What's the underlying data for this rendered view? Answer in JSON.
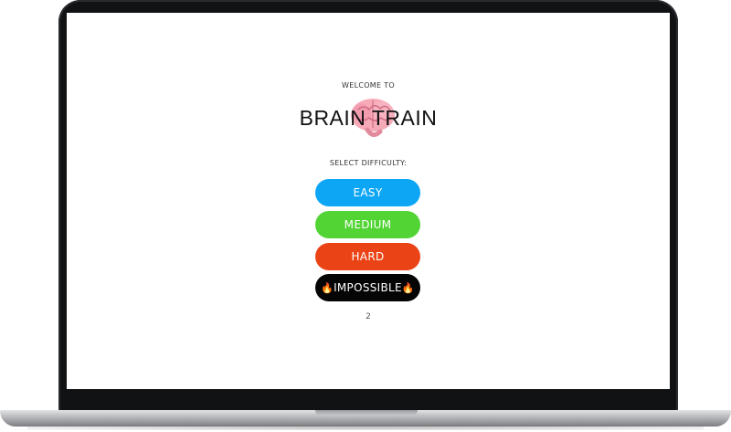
{
  "app": {
    "welcome": "WELCOME TO",
    "title": "BRAIN TRAIN",
    "brain_icon": "brain-icon",
    "select_label": "SELECT DIFFICULTY:",
    "counter": "2"
  },
  "difficulty": {
    "easy": {
      "label": "EASY",
      "color": "#0ca6f5"
    },
    "medium": {
      "label": "MEDIUM",
      "color": "#52d434"
    },
    "hard": {
      "label": "HARD",
      "color": "#ea4316"
    },
    "impossible": {
      "label": "IMPOSSIBLE",
      "color": "#050505",
      "icon": "fire-icon"
    }
  },
  "colors": {
    "bezel": "#111214",
    "screen": "#ffffff"
  }
}
